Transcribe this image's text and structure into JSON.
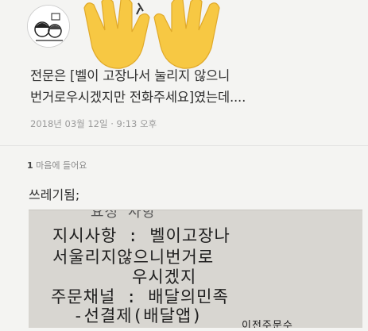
{
  "post": {
    "line1": "전문은 [벨이 고장나서 눌리지 않으니",
    "line2": "번거로우시겠지만 전화주세요]였는데....",
    "timestamp": "2018년 03월 12일 · 9:13 오후"
  },
  "reactions": {
    "count": "1",
    "label": "마음에 들어요"
  },
  "comment": "쓰레기됨;",
  "receipt": {
    "top_fragment": "요청 사항",
    "line1": "지시사항 : 벨이고장나",
    "line2": "서울리지않으니번거로",
    "line3": "우시겠지",
    "line4": "주문채널 : 배달의민족",
    "line5": "-선결제(배달앱)",
    "line6": "이전주문수"
  },
  "icons": {
    "avatar": "cartoon-avatar",
    "hands": "raised-hands-emoji"
  },
  "colors": {
    "emoji_yellow": "#f7c843",
    "background": "#f4f4f2",
    "receipt_paper": "#d8d6d1"
  }
}
